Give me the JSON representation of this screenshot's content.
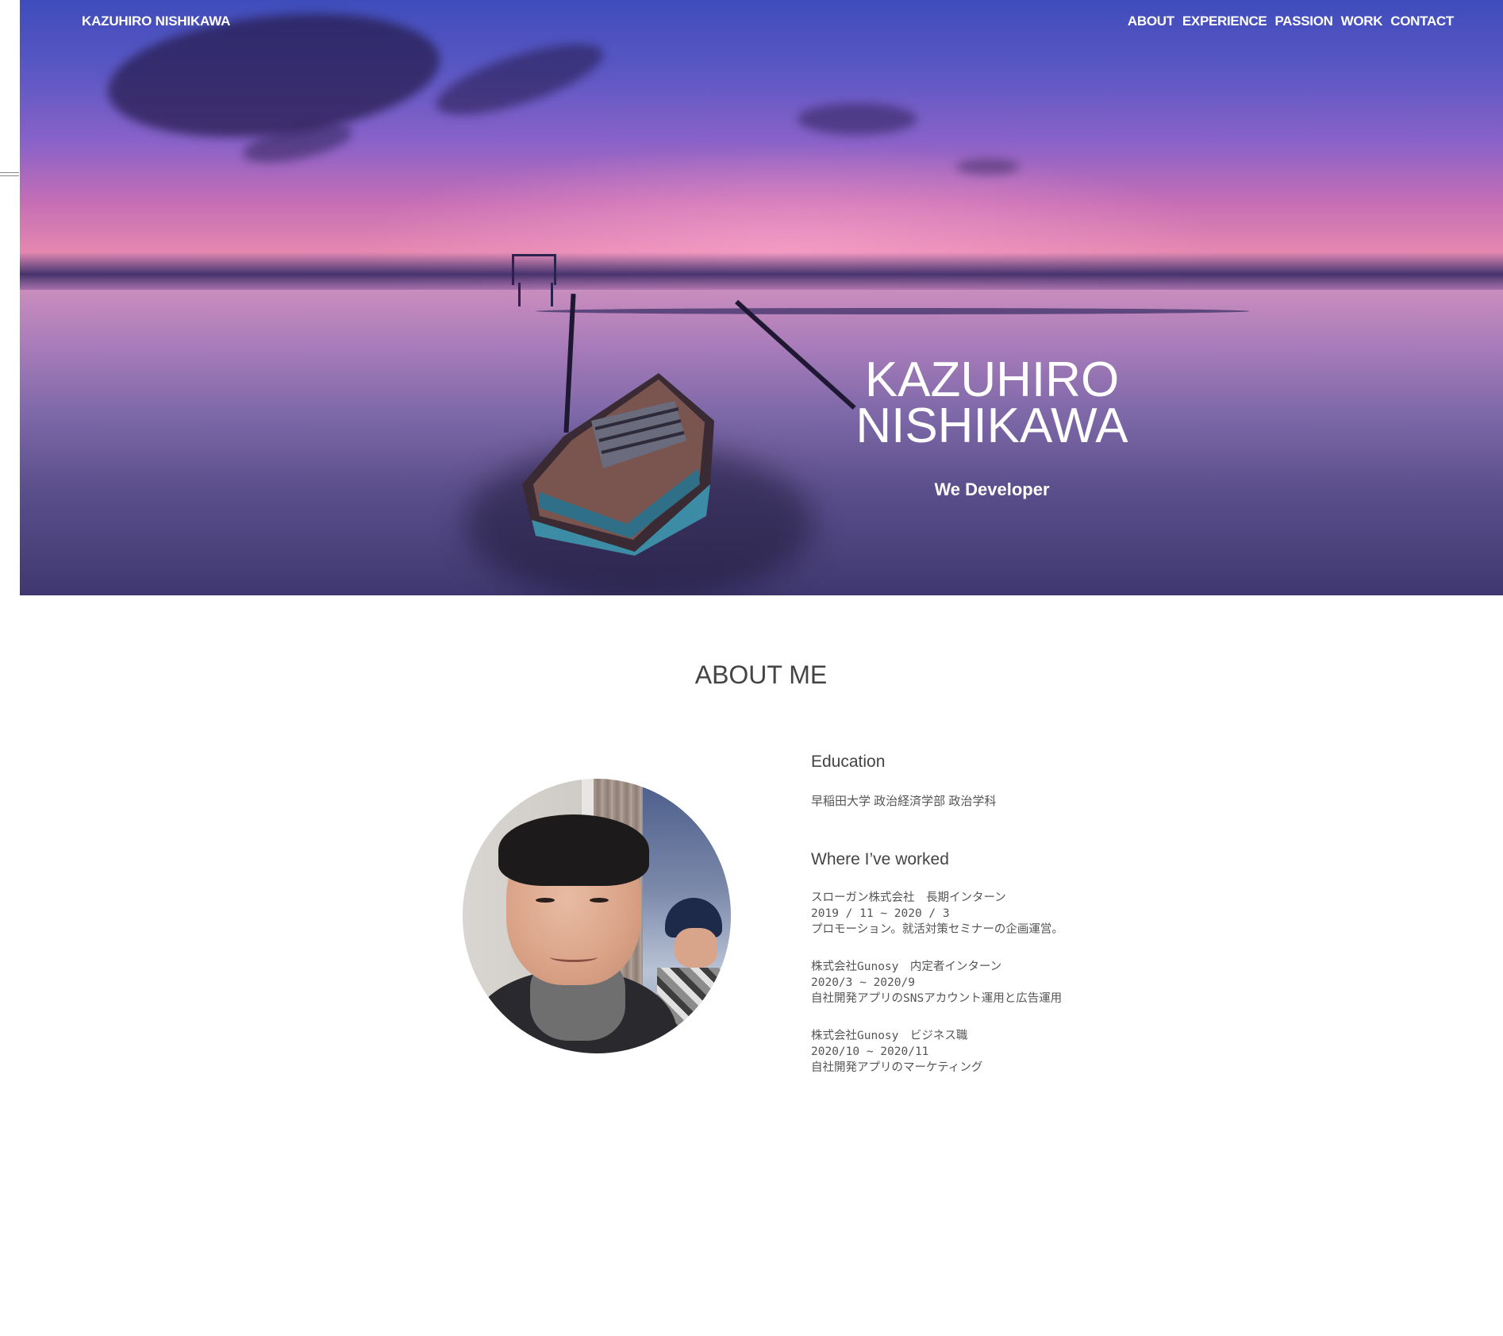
{
  "header": {
    "brand": "KAZUHIRO NISHIKAWA",
    "nav": [
      "ABOUT",
      "EXPERIENCE",
      "PASSION",
      "WORK",
      "CONTACT"
    ]
  },
  "hero": {
    "title_line1": "KAZUHIRO",
    "title_line2": "NISHIKAWA",
    "subtitle": "We Developer"
  },
  "about": {
    "title": "ABOUT ME",
    "education": {
      "heading": "Education",
      "school": "早稲田大学 政治経済学部 政治学科"
    },
    "work": {
      "heading": "Where I’ve worked",
      "jobs": [
        {
          "title": "スローガン株式会社　長期インターン",
          "period": "2019 / 11 ~ 2020 / 3",
          "description": "プロモーション。就活対策セミナーの企画運営。"
        },
        {
          "title": "株式会社Gunosy　内定者インターン",
          "period": "2020/3 ~ 2020/9",
          "description": "自社開発アプリのSNSアカウント運用と広告運用"
        },
        {
          "title": "株式会社Gunosy　ビジネス職",
          "period": "2020/10 ~ 2020/11",
          "description": "自社開発アプリのマーケティング"
        }
      ]
    }
  },
  "colors": {
    "sky_top": "#3e4dbb",
    "sky_pink": "#e486b0",
    "heading_text": "#444444",
    "body_text": "#555555"
  },
  "icons": {
    "profile_photo": "avatar"
  }
}
